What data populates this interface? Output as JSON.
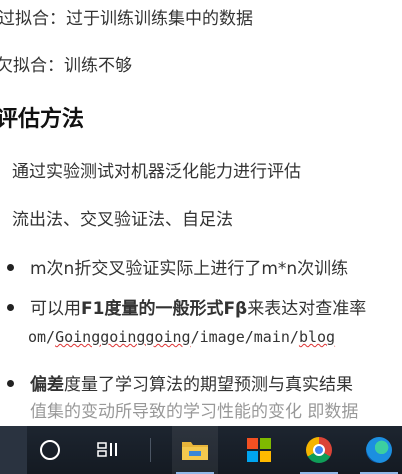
{
  "document": {
    "overfit_line": "过拟合：过于训练训练集中的数据",
    "underfit_line": "欠拟合：训练不够",
    "section_heading": "评估方法",
    "eval_line": "通过实验测试对机器泛化能力进行评估",
    "methods_line": "流出法、交叉验证法、自足法",
    "bullets": {
      "b1": "m次n折交叉验证实际上进行了m*n次训练",
      "b2_prefix": "可以用",
      "b2_bold": "F1度量的一般形式Fβ",
      "b2_suffix": "来表达对查准率",
      "b2_code_prefix": "om/",
      "b2_code_link1": "Goinggoinggoing",
      "b2_code_mid": "/image/main/",
      "b2_code_link2": "blog",
      "b3_bold": "偏差",
      "b3_rest": "度量了学习算法的期望预测与真实结果",
      "b4_partial": "值集的变动所导致的学习性能的变化 即数据"
    }
  },
  "taskbar": {
    "icons": [
      "start-icon",
      "cortana-search-icon",
      "task-view-icon",
      "file-explorer-icon",
      "microsoft-store-icon",
      "chrome-icon",
      "edge-icon"
    ]
  }
}
